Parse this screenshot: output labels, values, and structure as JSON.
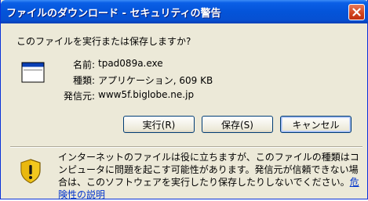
{
  "window": {
    "title": "ファイルのダウンロード - セキュリティの警告",
    "close_icon": "close-icon"
  },
  "dialog": {
    "question": "このファイルを実行または保存しますか?",
    "file_icon": "application-window-icon",
    "fields": {
      "name_label": "名前:",
      "name_value": "tpad089a.exe",
      "type_label": "種類:",
      "type_value": "アプリケーション, 609 KB",
      "from_label": "発信元:",
      "from_value": "www5f.biglobe.ne.jp"
    },
    "buttons": {
      "run": "実行(R)",
      "save": "保存(S)",
      "cancel": "キャンセル"
    },
    "warning": {
      "icon": "security-shield-warning-icon",
      "text": "インターネットのファイルは役に立ちますが、このファイルの種類はコンピュータに問題を起こす可能性があります。発信元が信頼できない場合は、このソフトウェアを実行したり保存したりしないでください。",
      "link": "危険性の説明"
    }
  },
  "colors": {
    "title_bar": "#0454d9",
    "dialog_bg": "#ece9d8",
    "link": "#0033cc"
  }
}
